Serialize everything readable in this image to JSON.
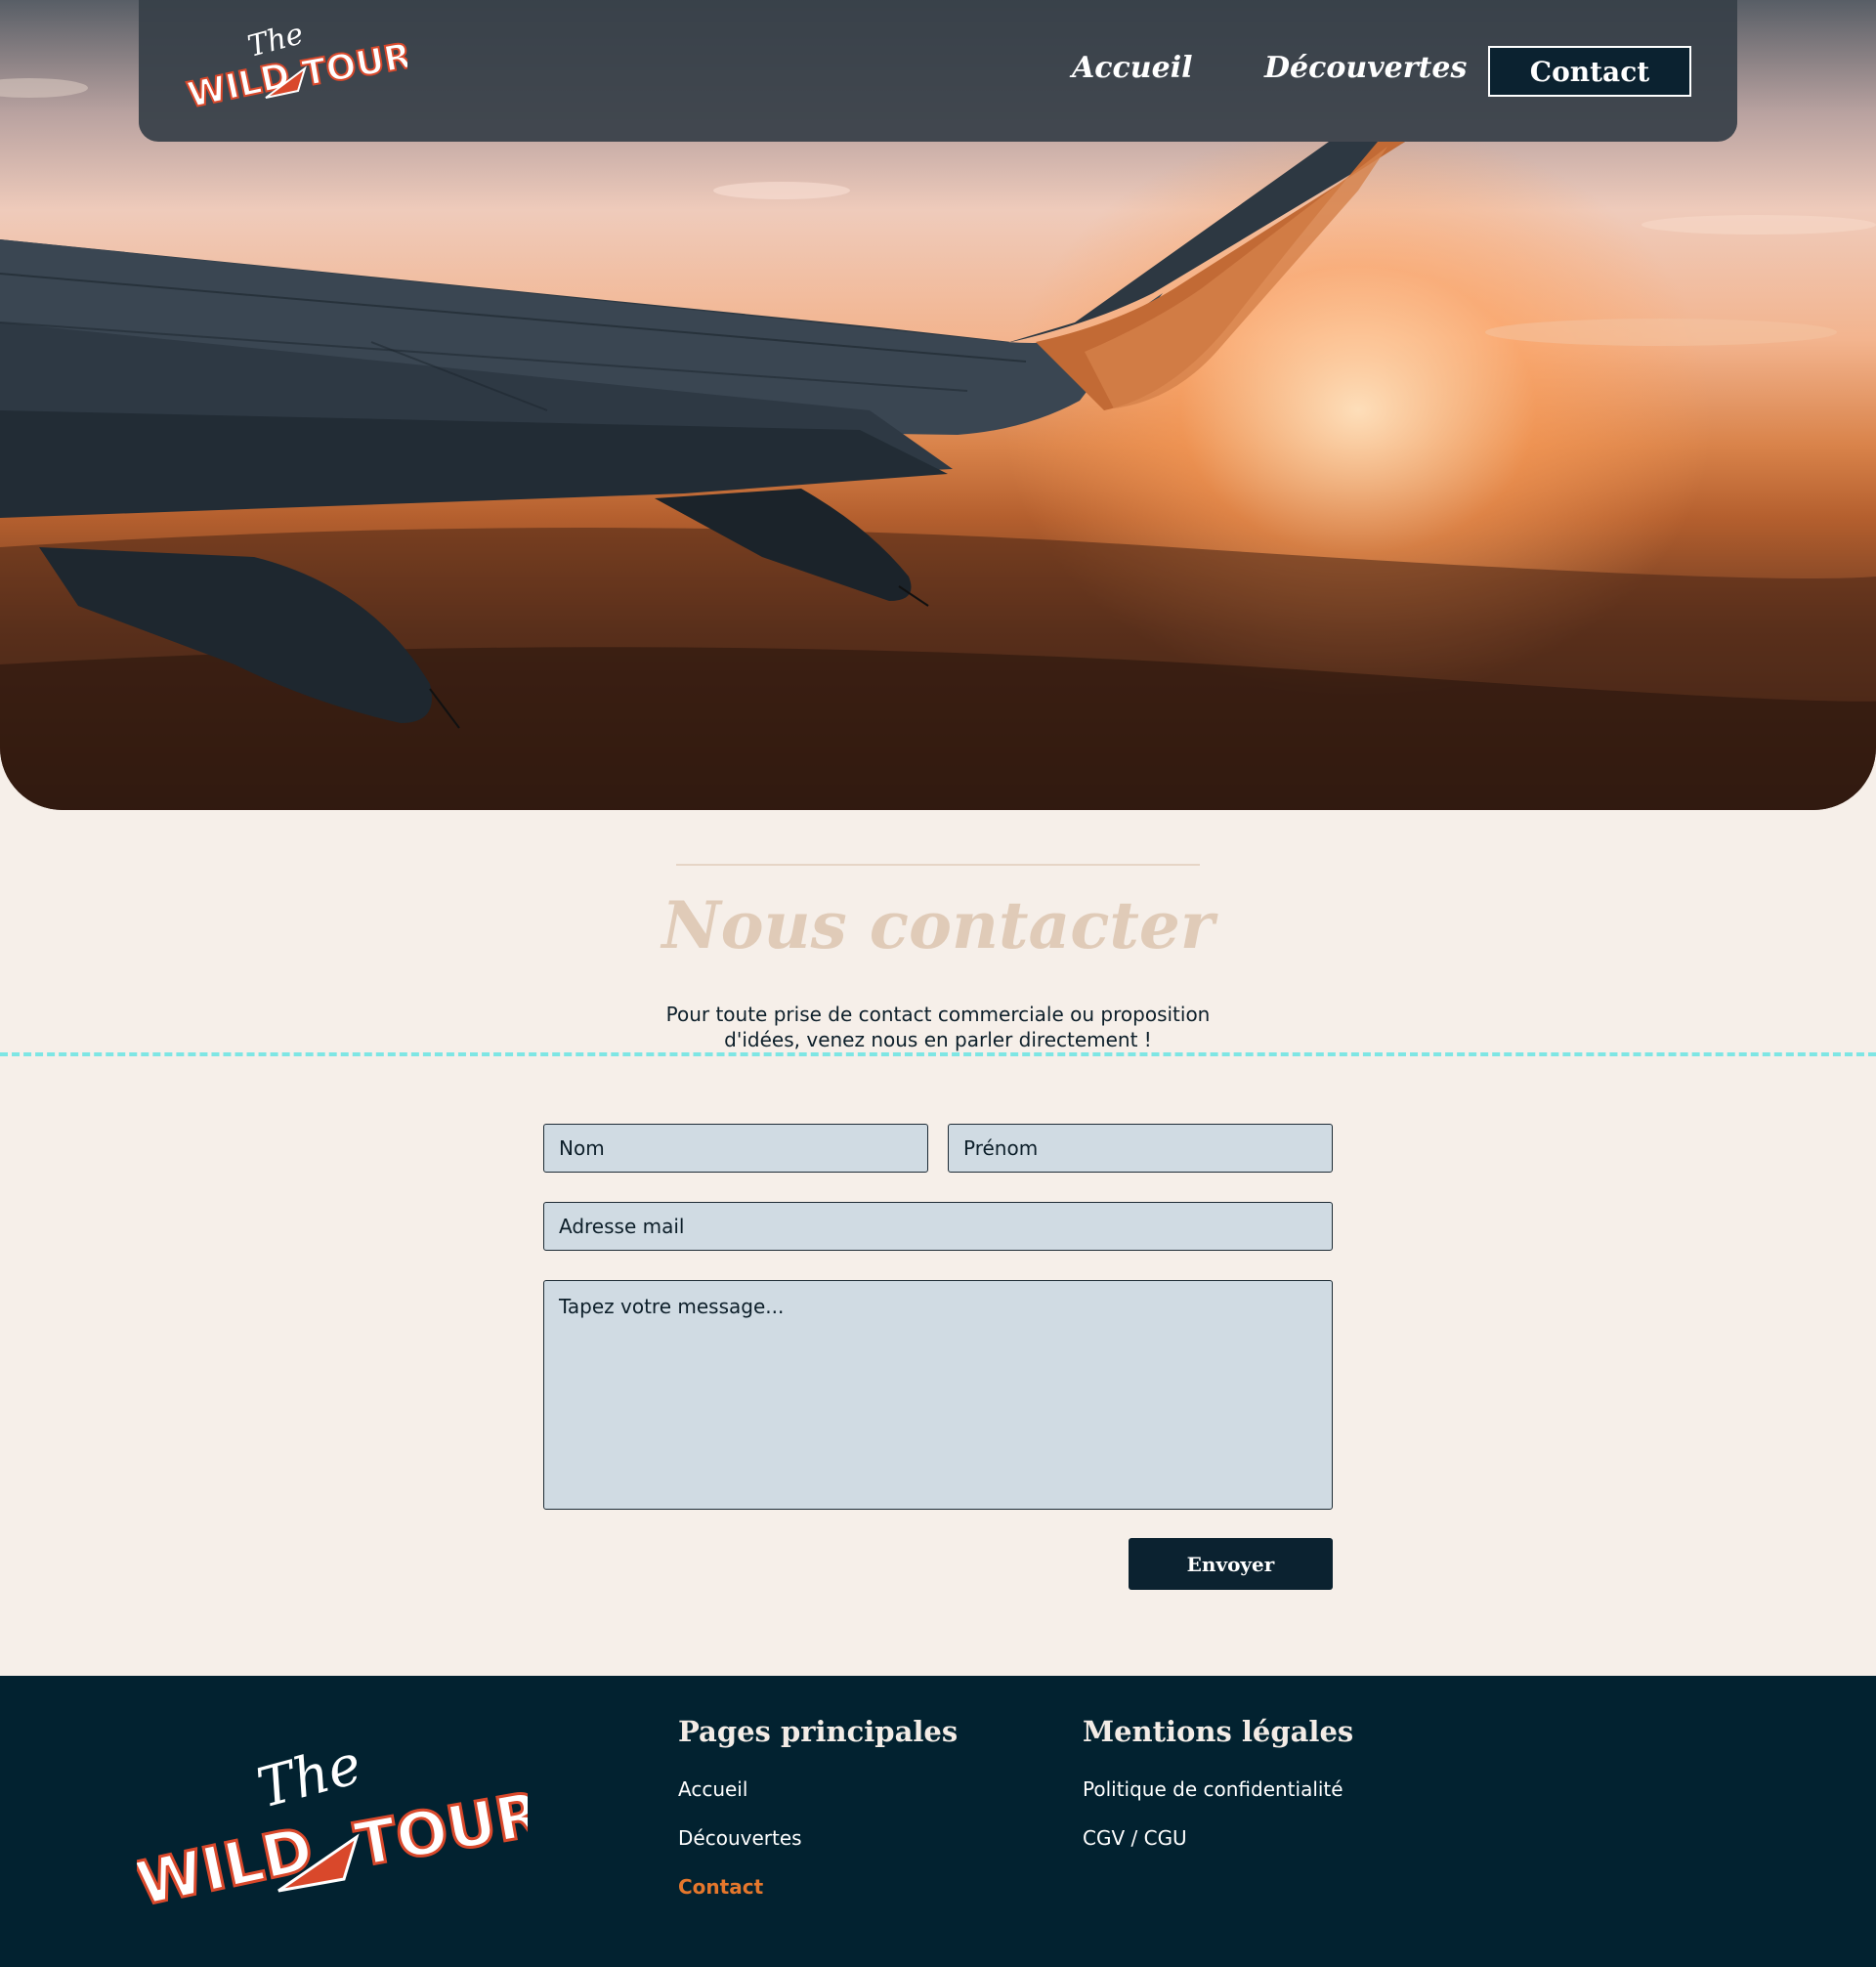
{
  "brand": {
    "name_top": "The",
    "name_left": "WILD",
    "name_right": "TOUR",
    "colors": {
      "primary_dark": "#0b2230",
      "accent_orange": "#e5772c",
      "logo_red": "#d9482b",
      "cream": "#f6efe9",
      "field_bg": "#d0dbe3"
    }
  },
  "nav": {
    "items": [
      {
        "label": "Accueil"
      },
      {
        "label": "Découvertes"
      },
      {
        "label": "Contact"
      }
    ]
  },
  "hero": {
    "image": "airplane-wing-sunset"
  },
  "contact": {
    "title": "Nous contacter",
    "description": "Pour toute prise de contact commerciale ou proposition d'idées, venez nous en parler directement !",
    "form": {
      "nom_placeholder": "Nom",
      "prenom_placeholder": "Prénom",
      "email_placeholder": "Adresse mail",
      "message_placeholder": "Tapez votre message...",
      "submit_label": "Envoyer"
    }
  },
  "footer": {
    "pages_heading": "Pages principales",
    "pages_links": [
      {
        "label": "Accueil"
      },
      {
        "label": "Découvertes"
      },
      {
        "label": "Contact"
      }
    ],
    "legal_heading": "Mentions légales",
    "legal_links": [
      {
        "label": "Politique de confidentialité"
      },
      {
        "label": "CGV / CGU"
      }
    ]
  }
}
